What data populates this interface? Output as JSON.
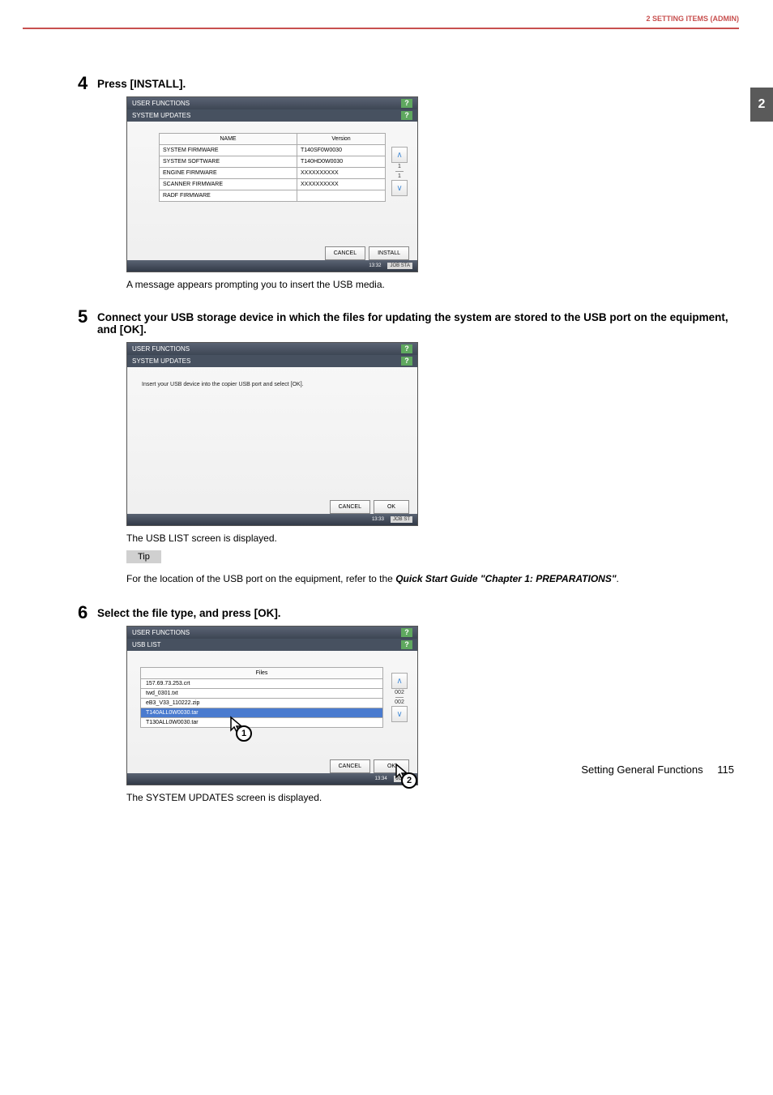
{
  "header": {
    "chapter": "2 SETTING ITEMS (ADMIN)"
  },
  "sideTab": "2",
  "step4": {
    "num": "4",
    "title": "Press [INSTALL].",
    "after": "A message appears prompting you to insert the USB media.",
    "screen": {
      "titlebar": "USER FUNCTIONS",
      "subtitle": "SYSTEM UPDATES",
      "help": "?",
      "cols": {
        "name": "NAME",
        "version": "Version"
      },
      "rows": [
        {
          "name": "SYSTEM FIRMWARE",
          "version": "T140SF0W0030"
        },
        {
          "name": "SYSTEM SOFTWARE",
          "version": "T140HD0W0030"
        },
        {
          "name": "ENGINE FIRMWARE",
          "version": "XXXXXXXXXX"
        },
        {
          "name": "SCANNER FIRMWARE",
          "version": "XXXXXXXXXX"
        },
        {
          "name": "RADF FIRMWARE",
          "version": ""
        }
      ],
      "scroll": {
        "page": "1",
        "total": "1"
      },
      "buttons": {
        "cancel": "CANCEL",
        "install": "INSTALL"
      },
      "footer": {
        "time": "13:32",
        "job": "JOB STA"
      }
    }
  },
  "step5": {
    "num": "5",
    "title": "Connect your USB storage device in which the files for updating the system are stored to the USB port on the equipment, and [OK].",
    "after": "The USB LIST screen is displayed.",
    "screen": {
      "titlebar": "USER FUNCTIONS",
      "subtitle": "SYSTEM UPDATES",
      "help": "?",
      "msg": "Insert your USB device into the copier USB port and select [OK].",
      "buttons": {
        "cancel": "CANCEL",
        "ok": "OK"
      },
      "footer": {
        "time": "13:33",
        "job": "JOB ST"
      }
    },
    "tip": {
      "label": "Tip",
      "text_pre": "For the location of the USB port on the equipment, refer to the ",
      "text_bold": "Quick Start Guide \"Chapter 1: PREPARATIONS\"",
      "text_post": "."
    }
  },
  "step6": {
    "num": "6",
    "title": "Select the file type, and press [OK].",
    "after": "The SYSTEM UPDATES screen is displayed.",
    "screen": {
      "titlebar": "USER FUNCTIONS",
      "subtitle": "USB LIST",
      "help": "?",
      "filesHeader": "Files",
      "files": [
        {
          "name": "157.69.73.253.crt",
          "selected": false
        },
        {
          "name": "twd_0301.txt",
          "selected": false
        },
        {
          "name": "eB3_V33_110222.zip",
          "selected": false
        },
        {
          "name": "T140ALL0W0030.tar",
          "selected": true
        },
        {
          "name": "T130ALL0W0030.tar",
          "selected": false
        }
      ],
      "scroll": {
        "page": "002",
        "total": "002"
      },
      "buttons": {
        "cancel": "CANCEL",
        "ok": "OK"
      },
      "footer": {
        "time": "13:34",
        "job": "JOB S"
      }
    },
    "pointers": {
      "p1": "1",
      "p2": "2"
    }
  },
  "footer": {
    "section": "Setting General Functions",
    "page": "115"
  }
}
